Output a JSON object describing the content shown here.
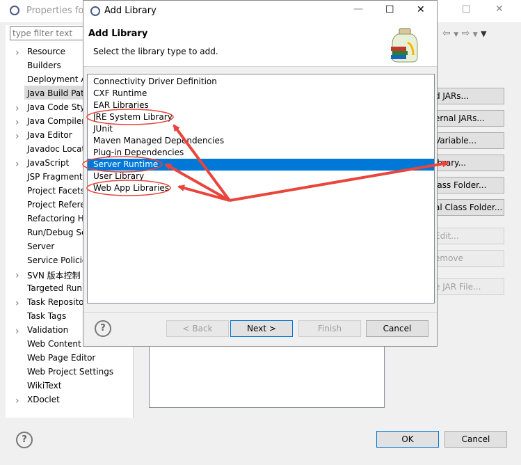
{
  "background": {
    "title": "Properties for",
    "filter_placeholder": "type filter text",
    "tree": [
      {
        "label": "Resource",
        "arrow": true
      },
      {
        "label": "Builders",
        "arrow": false
      },
      {
        "label": "Deployment A",
        "arrow": false
      },
      {
        "label": "Java Build Pat",
        "arrow": false,
        "selected": true
      },
      {
        "label": "Java Code Sty",
        "arrow": true
      },
      {
        "label": "Java Compiler",
        "arrow": true
      },
      {
        "label": "Java Editor",
        "arrow": true
      },
      {
        "label": "Javadoc Locat",
        "arrow": false
      },
      {
        "label": "JavaScript",
        "arrow": true
      },
      {
        "label": "JSP Fragment",
        "arrow": false
      },
      {
        "label": "Project Facets",
        "arrow": false
      },
      {
        "label": "Project Refere",
        "arrow": false
      },
      {
        "label": "Refactoring H",
        "arrow": false
      },
      {
        "label": "Run/Debug Se",
        "arrow": false
      },
      {
        "label": "Server",
        "arrow": false
      },
      {
        "label": "Service Policie",
        "arrow": false
      },
      {
        "label": "SVN 版本控制",
        "arrow": true
      },
      {
        "label": "Targeted Run",
        "arrow": false
      },
      {
        "label": "Task Reposito",
        "arrow": true
      },
      {
        "label": "Task Tags",
        "arrow": false
      },
      {
        "label": "Validation",
        "arrow": true
      },
      {
        "label": "Web Content",
        "arrow": false
      },
      {
        "label": "Web Page Editor",
        "arrow": false
      },
      {
        "label": "Web Project Settings",
        "arrow": false
      },
      {
        "label": "WikiText",
        "arrow": false
      },
      {
        "label": "XDoclet",
        "arrow": true
      }
    ],
    "right_buttons": [
      {
        "label": "d JARs...",
        "enabled": true
      },
      {
        "label": "ernal JARs...",
        "enabled": true
      },
      {
        "label": "Variable...",
        "enabled": true
      },
      {
        "label": "ibrary...",
        "enabled": true
      },
      {
        "label": "lass Folder...",
        "enabled": true
      },
      {
        "label": "al Class Folder...",
        "enabled": true
      },
      {
        "label": "Edit...",
        "enabled": false
      },
      {
        "label": "emove",
        "enabled": false
      },
      {
        "label": "e JAR File...",
        "enabled": false
      }
    ],
    "ok_label": "OK",
    "cancel_label": "Cancel"
  },
  "dialog": {
    "title": "Add Library",
    "heading": "Add Library",
    "description": "Select the library type to add.",
    "libraries": [
      {
        "label": "Connectivity Driver Definition",
        "selected": false,
        "circled": false
      },
      {
        "label": "CXF Runtime",
        "selected": false,
        "circled": false
      },
      {
        "label": "EAR Libraries",
        "selected": false,
        "circled": false
      },
      {
        "label": "JRE System Library",
        "selected": false,
        "circled": true
      },
      {
        "label": "JUnit",
        "selected": false,
        "circled": false
      },
      {
        "label": "Maven Managed Dependencies",
        "selected": false,
        "circled": false
      },
      {
        "label": "Plug-in Dependencies",
        "selected": false,
        "circled": false
      },
      {
        "label": "Server Runtime",
        "selected": true,
        "circled": true
      },
      {
        "label": "User Library",
        "selected": false,
        "circled": false
      },
      {
        "label": "Web App Libraries",
        "selected": false,
        "circled": true
      }
    ],
    "back_label": "< Back",
    "next_label": "Next >",
    "finish_label": "Finish",
    "cancel_label": "Cancel"
  },
  "colors": {
    "selection": "#0078d7",
    "annotation": "#e8453c"
  }
}
